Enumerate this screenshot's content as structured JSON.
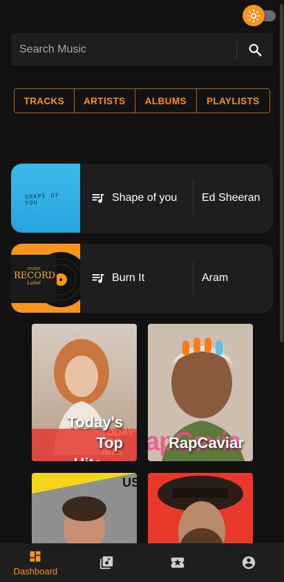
{
  "theme": {
    "accent": "#f7941d",
    "background": "#121212",
    "surface": "#1e1e1e"
  },
  "theme_toggle": {
    "icon": "sun-icon"
  },
  "search": {
    "placeholder": "Search Music",
    "icon": "search-icon"
  },
  "tabs": [
    {
      "label": "TRACKS"
    },
    {
      "label": "ARTISTS"
    },
    {
      "label": "ALBUMS"
    },
    {
      "label": "PLAYLISTS"
    }
  ],
  "tracks": [
    {
      "title": "Shape of you",
      "artist": "Ed Sheeran",
      "art_text": "SHAPE OF YOU",
      "icon": "playlist-music-icon"
    },
    {
      "title": "Burn It",
      "artist": "Aram",
      "art_text": [
        "STUDIO",
        "RECORD",
        "Label"
      ],
      "icon": "playlist-music-icon"
    }
  ],
  "playlists": [
    {
      "title": "Today's Top Hits",
      "line1": "Today's Top",
      "line2": "Hits",
      "bg_text": [
        "TODAY'S",
        "TOP",
        "HITS"
      ]
    },
    {
      "title": "RapCaviar",
      "bg_text": "apCavia"
    },
    {
      "title": "",
      "bg_text": "US"
    },
    {
      "title": ""
    }
  ],
  "bottom_nav": [
    {
      "label": "Dashboard",
      "icon": "dashboard-icon",
      "active": true
    },
    {
      "label": "",
      "icon": "library-music-icon",
      "active": false
    },
    {
      "label": "",
      "icon": "local-activity-icon",
      "active": false
    },
    {
      "label": "",
      "icon": "account-circle-icon",
      "active": false
    }
  ]
}
